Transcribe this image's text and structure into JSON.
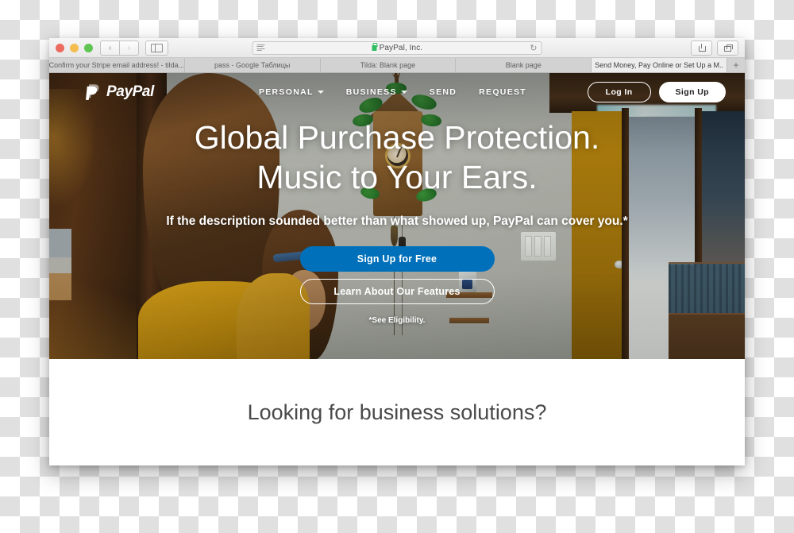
{
  "browser": {
    "window_controls": [
      "close",
      "minimize",
      "maximize"
    ],
    "back_label": "‹",
    "forward_label": "›",
    "url_title": "PayPal, Inc.",
    "reload_label": "↻",
    "tabs": [
      {
        "title": "Confirm your Stripe email address! - tilda...",
        "active": false
      },
      {
        "title": "pass - Google Таблицы",
        "active": false
      },
      {
        "title": "Tilda: Blank page",
        "active": false
      },
      {
        "title": "Blank page",
        "active": false
      },
      {
        "title": "Send Money, Pay Online or Set Up a M..",
        "active": true
      }
    ],
    "new_tab_label": "+"
  },
  "site": {
    "brand": "PayPal",
    "nav_links": [
      {
        "label": "PERSONAL",
        "has_chevron": true
      },
      {
        "label": "BUSINESS",
        "has_chevron": true
      },
      {
        "label": "SEND",
        "has_chevron": false
      },
      {
        "label": "REQUEST",
        "has_chevron": false
      }
    ],
    "login_label": "Log In",
    "signup_label": "Sign Up"
  },
  "hero": {
    "headline_line1": "Global Purchase Protection.",
    "headline_line2": "Music to Your Ears.",
    "subhead": "If the description sounded better than what showed up, PayPal can cover you.*",
    "cta_primary": "Sign Up for Free",
    "cta_secondary": "Learn About Our Features",
    "footnote": "*See Eligibility."
  },
  "lower_section": {
    "heading": "Looking for business solutions?"
  },
  "colors": {
    "paypal_blue": "#0070ba",
    "secure_green": "#2fbe63",
    "hero_text": "#ffffff",
    "lower_heading": "#4a4a4a"
  }
}
